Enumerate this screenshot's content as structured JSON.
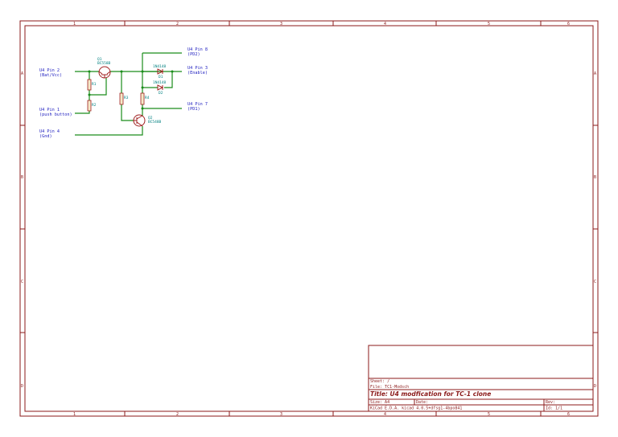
{
  "border": {
    "columns": [
      "1",
      "2",
      "3",
      "4",
      "5",
      "6"
    ],
    "rows": [
      "A",
      "B",
      "C",
      "D"
    ]
  },
  "labels": {
    "pin2": {
      "name": "U4 Pin 2",
      "desc": "(Bat/Vcc)"
    },
    "pin1": {
      "name": "U4 Pin 1",
      "desc": "(push button)"
    },
    "pin4": {
      "name": "U4 Pin 4",
      "desc": "(Gnd)"
    },
    "pin8": {
      "name": "U4 Pin 8",
      "desc": "(PD2)"
    },
    "pin3": {
      "name": "U4 Pin 3",
      "desc": "(Enable)"
    },
    "pin7": {
      "name": "U4 Pin 7",
      "desc": "(PD1)"
    }
  },
  "components": {
    "q1": {
      "ref": "Q1",
      "value": "BC558B"
    },
    "q2": {
      "ref": "Q2",
      "value": "BC548B"
    },
    "d1": {
      "ref": "D1",
      "value": "1N4148"
    },
    "d2": {
      "ref": "D2",
      "value": "1N4148"
    },
    "r1": {
      "ref": "R1"
    },
    "r2": {
      "ref": "R2"
    },
    "r3": {
      "ref": "R3"
    },
    "r4": {
      "ref": "R4"
    }
  },
  "title_block": {
    "sheet": "Sheet: /",
    "file": "File: TC1-Modsch",
    "title": "Title: U4 modfication for TC-1 clone",
    "size": "Size: A4",
    "date": "Date:",
    "rev": "Rev:",
    "kicad": "KiCad E.D.A.  kicad 4.0.5+dfsg1-4bpo841",
    "id": "Id: 1/1"
  }
}
